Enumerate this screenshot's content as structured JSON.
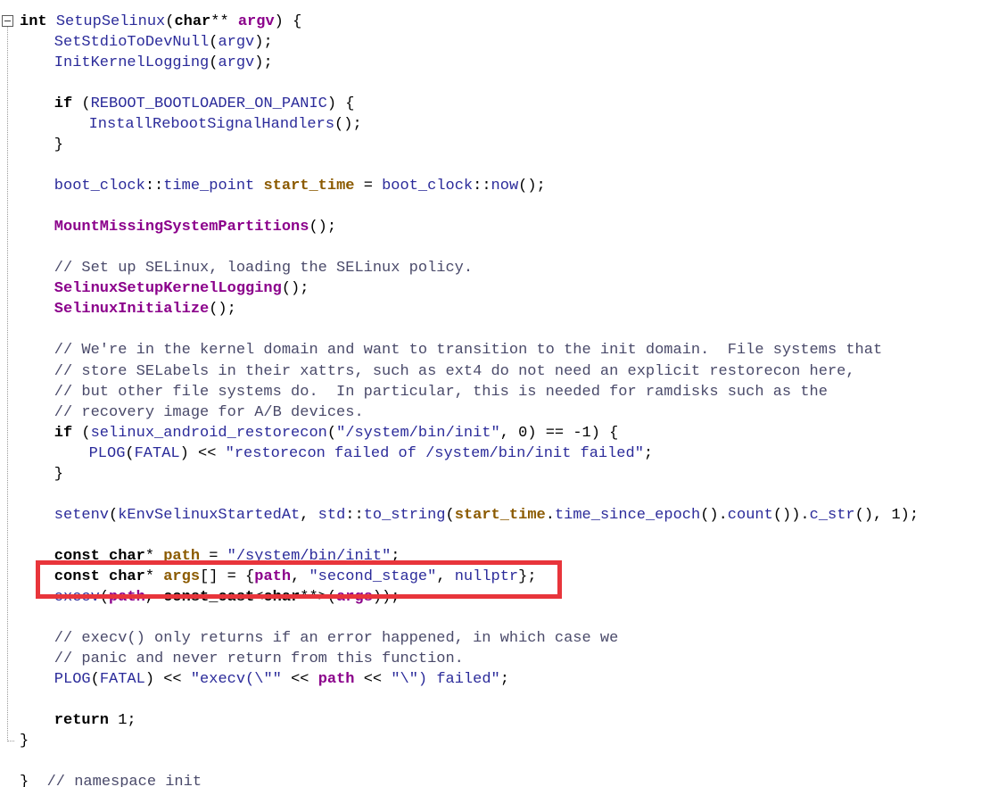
{
  "editor": {
    "lines": [
      {
        "indent": "",
        "tokens": [
          {
            "t": "int ",
            "c": "kw"
          },
          {
            "t": "SetupSelinux",
            "c": "fn"
          },
          {
            "t": "(",
            "c": "pu"
          },
          {
            "t": "char",
            "c": "kw"
          },
          {
            "t": "** ",
            "c": "op"
          },
          {
            "t": "argv",
            "c": "prm"
          },
          {
            "t": ") {",
            "c": "pu"
          }
        ]
      },
      {
        "indent": "    ",
        "tokens": [
          {
            "t": "SetStdioToDevNull",
            "c": "fn"
          },
          {
            "t": "(",
            "c": "pu"
          },
          {
            "t": "argv",
            "c": "id"
          },
          {
            "t": ");",
            "c": "pu"
          }
        ]
      },
      {
        "indent": "    ",
        "tokens": [
          {
            "t": "InitKernelLogging",
            "c": "fn"
          },
          {
            "t": "(",
            "c": "pu"
          },
          {
            "t": "argv",
            "c": "id"
          },
          {
            "t": ");",
            "c": "pu"
          }
        ]
      },
      {
        "indent": "",
        "tokens": []
      },
      {
        "indent": "    ",
        "tokens": [
          {
            "t": "if",
            "c": "kw"
          },
          {
            "t": " (",
            "c": "pu"
          },
          {
            "t": "REBOOT_BOOTLOADER_ON_PANIC",
            "c": "id"
          },
          {
            "t": ") {",
            "c": "pu"
          }
        ]
      },
      {
        "indent": "        ",
        "tokens": [
          {
            "t": "InstallRebootSignalHandlers",
            "c": "fn"
          },
          {
            "t": "();",
            "c": "pu"
          }
        ]
      },
      {
        "indent": "    ",
        "tokens": [
          {
            "t": "}",
            "c": "pu"
          }
        ]
      },
      {
        "indent": "",
        "tokens": []
      },
      {
        "indent": "    ",
        "tokens": [
          {
            "t": "boot_clock",
            "c": "id"
          },
          {
            "t": "::",
            "c": "pu"
          },
          {
            "t": "time_point",
            "c": "id"
          },
          {
            "t": " ",
            "c": "pu"
          },
          {
            "t": "start_time",
            "c": "var"
          },
          {
            "t": " = ",
            "c": "op"
          },
          {
            "t": "boot_clock",
            "c": "id"
          },
          {
            "t": "::",
            "c": "pu"
          },
          {
            "t": "now",
            "c": "fn"
          },
          {
            "t": "();",
            "c": "pu"
          }
        ]
      },
      {
        "indent": "",
        "tokens": []
      },
      {
        "indent": "    ",
        "tokens": [
          {
            "t": "MountMissingSystemPartitions",
            "c": "fnb"
          },
          {
            "t": "();",
            "c": "pu"
          }
        ]
      },
      {
        "indent": "",
        "tokens": []
      },
      {
        "indent": "    ",
        "tokens": [
          {
            "t": "// Set up SELinux, loading the SELinux policy.",
            "c": "cm"
          }
        ]
      },
      {
        "indent": "    ",
        "tokens": [
          {
            "t": "SelinuxSetupKernelLogging",
            "c": "fnb"
          },
          {
            "t": "();",
            "c": "pu"
          }
        ]
      },
      {
        "indent": "    ",
        "tokens": [
          {
            "t": "SelinuxInitialize",
            "c": "fnb"
          },
          {
            "t": "();",
            "c": "pu"
          }
        ]
      },
      {
        "indent": "",
        "tokens": []
      },
      {
        "indent": "    ",
        "tokens": [
          {
            "t": "// We're in the kernel domain and want to transition to the init domain.  File systems that",
            "c": "cm"
          }
        ]
      },
      {
        "indent": "    ",
        "tokens": [
          {
            "t": "// store SELabels in their xattrs, such as ext4 do not need an explicit restorecon here,",
            "c": "cm"
          }
        ]
      },
      {
        "indent": "    ",
        "tokens": [
          {
            "t": "// but other file systems do.  In particular, this is needed for ramdisks such as the",
            "c": "cm"
          }
        ]
      },
      {
        "indent": "    ",
        "tokens": [
          {
            "t": "// recovery image for A/B devices.",
            "c": "cm"
          }
        ]
      },
      {
        "indent": "    ",
        "tokens": [
          {
            "t": "if",
            "c": "kw"
          },
          {
            "t": " (",
            "c": "pu"
          },
          {
            "t": "selinux_android_restorecon",
            "c": "fn"
          },
          {
            "t": "(",
            "c": "pu"
          },
          {
            "t": "\"/system/bin/init\"",
            "c": "str"
          },
          {
            "t": ", ",
            "c": "pu"
          },
          {
            "t": "0",
            "c": "num"
          },
          {
            "t": ") == ",
            "c": "op"
          },
          {
            "t": "-1",
            "c": "num"
          },
          {
            "t": ") {",
            "c": "pu"
          }
        ]
      },
      {
        "indent": "        ",
        "tokens": [
          {
            "t": "PLOG",
            "c": "fn"
          },
          {
            "t": "(",
            "c": "pu"
          },
          {
            "t": "FATAL",
            "c": "id"
          },
          {
            "t": ") << ",
            "c": "op"
          },
          {
            "t": "\"restorecon failed of /system/bin/init failed\"",
            "c": "str"
          },
          {
            "t": ";",
            "c": "pu"
          }
        ]
      },
      {
        "indent": "    ",
        "tokens": [
          {
            "t": "}",
            "c": "pu"
          }
        ]
      },
      {
        "indent": "",
        "tokens": []
      },
      {
        "indent": "    ",
        "tokens": [
          {
            "t": "setenv",
            "c": "fn"
          },
          {
            "t": "(",
            "c": "pu"
          },
          {
            "t": "kEnvSelinuxStartedAt",
            "c": "id"
          },
          {
            "t": ", ",
            "c": "pu"
          },
          {
            "t": "std",
            "c": "id"
          },
          {
            "t": "::",
            "c": "pu"
          },
          {
            "t": "to_string",
            "c": "fn"
          },
          {
            "t": "(",
            "c": "pu"
          },
          {
            "t": "start_time",
            "c": "var"
          },
          {
            "t": ".",
            "c": "pu"
          },
          {
            "t": "time_since_epoch",
            "c": "fn"
          },
          {
            "t": "().",
            "c": "pu"
          },
          {
            "t": "count",
            "c": "fn"
          },
          {
            "t": "()).",
            "c": "pu"
          },
          {
            "t": "c_str",
            "c": "fn"
          },
          {
            "t": "(), ",
            "c": "pu"
          },
          {
            "t": "1",
            "c": "num"
          },
          {
            "t": ");",
            "c": "pu"
          }
        ]
      },
      {
        "indent": "",
        "tokens": []
      },
      {
        "indent": "    ",
        "tokens": [
          {
            "t": "const",
            "c": "kw"
          },
          {
            "t": " ",
            "c": "pu"
          },
          {
            "t": "char",
            "c": "kw"
          },
          {
            "t": "* ",
            "c": "op"
          },
          {
            "t": "path",
            "c": "var"
          },
          {
            "t": " = ",
            "c": "op"
          },
          {
            "t": "\"/system/bin/init\"",
            "c": "str"
          },
          {
            "t": ";",
            "c": "pu"
          }
        ]
      },
      {
        "indent": "    ",
        "tokens": [
          {
            "t": "const",
            "c": "kw"
          },
          {
            "t": " ",
            "c": "pu"
          },
          {
            "t": "char",
            "c": "kw"
          },
          {
            "t": "* ",
            "c": "op"
          },
          {
            "t": "args",
            "c": "var"
          },
          {
            "t": "[] = {",
            "c": "pu"
          },
          {
            "t": "path",
            "c": "prm"
          },
          {
            "t": ", ",
            "c": "pu"
          },
          {
            "t": "\"second_stage\"",
            "c": "str"
          },
          {
            "t": ", ",
            "c": "pu"
          },
          {
            "t": "nullptr",
            "c": "id"
          },
          {
            "t": "};",
            "c": "pu"
          }
        ]
      },
      {
        "indent": "    ",
        "tokens": [
          {
            "t": "execv",
            "c": "fn"
          },
          {
            "t": "(",
            "c": "pu"
          },
          {
            "t": "path",
            "c": "prm"
          },
          {
            "t": ", ",
            "c": "pu"
          },
          {
            "t": "const_cast",
            "c": "kw"
          },
          {
            "t": "<",
            "c": "pu"
          },
          {
            "t": "char",
            "c": "kw"
          },
          {
            "t": "**>(",
            "c": "pu"
          },
          {
            "t": "args",
            "c": "prm"
          },
          {
            "t": "));",
            "c": "pu"
          }
        ]
      },
      {
        "indent": "",
        "tokens": []
      },
      {
        "indent": "    ",
        "tokens": [
          {
            "t": "// execv() only returns if an error happened, in which case we",
            "c": "cm"
          }
        ]
      },
      {
        "indent": "    ",
        "tokens": [
          {
            "t": "// panic and never return from this function.",
            "c": "cm"
          }
        ]
      },
      {
        "indent": "    ",
        "tokens": [
          {
            "t": "PLOG",
            "c": "fn"
          },
          {
            "t": "(",
            "c": "pu"
          },
          {
            "t": "FATAL",
            "c": "id"
          },
          {
            "t": ") << ",
            "c": "op"
          },
          {
            "t": "\"execv(\\\"\"",
            "c": "str"
          },
          {
            "t": " << ",
            "c": "op"
          },
          {
            "t": "path",
            "c": "prm"
          },
          {
            "t": " << ",
            "c": "op"
          },
          {
            "t": "\"\\\") failed\"",
            "c": "str"
          },
          {
            "t": ";",
            "c": "pu"
          }
        ]
      },
      {
        "indent": "",
        "tokens": []
      },
      {
        "indent": "    ",
        "tokens": [
          {
            "t": "return",
            "c": "kw"
          },
          {
            "t": " ",
            "c": "pu"
          },
          {
            "t": "1",
            "c": "num"
          },
          {
            "t": ";",
            "c": "pu"
          }
        ]
      },
      {
        "indent": "",
        "tokens": [
          {
            "t": "}",
            "c": "pu"
          }
        ]
      },
      {
        "indent": "",
        "tokens": []
      },
      {
        "indent": "",
        "tokens": [
          {
            "t": "}  ",
            "c": "pu"
          },
          {
            "t": "// namespace init",
            "c": "cm"
          }
        ]
      }
    ]
  },
  "colors": {
    "highlight_border": "#e8353b",
    "keyword": "#000000",
    "function": "#2b2b9a",
    "string": "#2b2b9a",
    "comment": "#4a4a6a"
  }
}
